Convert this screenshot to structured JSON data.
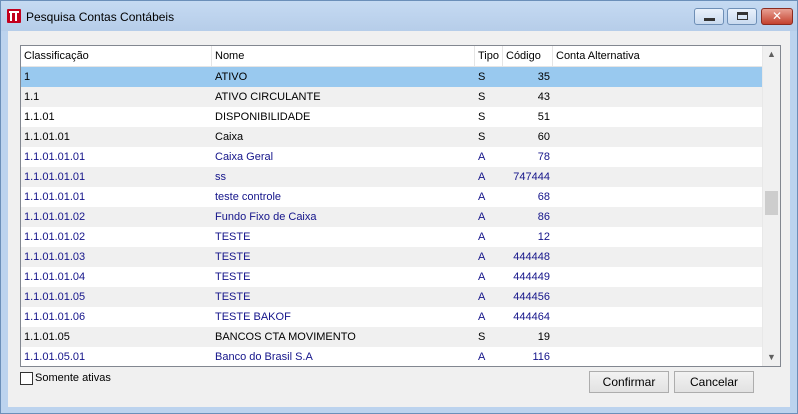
{
  "window": {
    "title": "Pesquisa Contas Contábeis",
    "close_glyph": "✕"
  },
  "grid": {
    "columns": [
      "Classificação",
      "Nome",
      "Tipo",
      "Código",
      "Conta Alternativa"
    ],
    "rows": [
      {
        "cls": "1",
        "nome": "ATIVO",
        "tipo": "S",
        "cod": "35",
        "alt": ""
      },
      {
        "cls": "1.1",
        "nome": "ATIVO CIRCULANTE",
        "tipo": "S",
        "cod": "43",
        "alt": ""
      },
      {
        "cls": "1.1.01",
        "nome": "DISPONIBILIDADE",
        "tipo": "S",
        "cod": "51",
        "alt": ""
      },
      {
        "cls": "1.1.01.01",
        "nome": "Caixa",
        "tipo": "S",
        "cod": "60",
        "alt": ""
      },
      {
        "cls": "1.1.01.01.01",
        "nome": "Caixa Geral",
        "tipo": "A",
        "cod": "78",
        "alt": ""
      },
      {
        "cls": "1.1.01.01.01",
        "nome": "ss",
        "tipo": "A",
        "cod": "747444",
        "alt": ""
      },
      {
        "cls": "1.1.01.01.01",
        "nome": "teste controle",
        "tipo": "A",
        "cod": "68",
        "alt": ""
      },
      {
        "cls": "1.1.01.01.02",
        "nome": "Fundo Fixo de Caixa",
        "tipo": "A",
        "cod": "86",
        "alt": ""
      },
      {
        "cls": "1.1.01.01.02",
        "nome": "TESTE",
        "tipo": "A",
        "cod": "12",
        "alt": ""
      },
      {
        "cls": "1.1.01.01.03",
        "nome": "TESTE",
        "tipo": "A",
        "cod": "444448",
        "alt": ""
      },
      {
        "cls": "1.1.01.01.04",
        "nome": "TESTE",
        "tipo": "A",
        "cod": "444449",
        "alt": ""
      },
      {
        "cls": "1.1.01.01.05",
        "nome": "TESTE",
        "tipo": "A",
        "cod": "444456",
        "alt": ""
      },
      {
        "cls": "1.1.01.01.06",
        "nome": "TESTE BAKOF",
        "tipo": "A",
        "cod": "444464",
        "alt": ""
      },
      {
        "cls": "1.1.01.05",
        "nome": "BANCOS CTA MOVIMENTO",
        "tipo": "S",
        "cod": "19",
        "alt": ""
      },
      {
        "cls": "1.1.01.05.01",
        "nome": "Banco do Brasil S.A",
        "tipo": "A",
        "cod": "116",
        "alt": ""
      }
    ],
    "selected_row": 0,
    "scroll_up_glyph": "▲",
    "scroll_down_glyph": "▼"
  },
  "filters": {
    "only_active_label": "Somente ativas",
    "only_active_checked": false
  },
  "buttons": {
    "confirm": "Confirmar",
    "cancel": "Cancelar"
  },
  "colors": {
    "selected_row": "#99c9ef",
    "analytic_text": "#14148a",
    "synthetic_text": "#000000"
  }
}
